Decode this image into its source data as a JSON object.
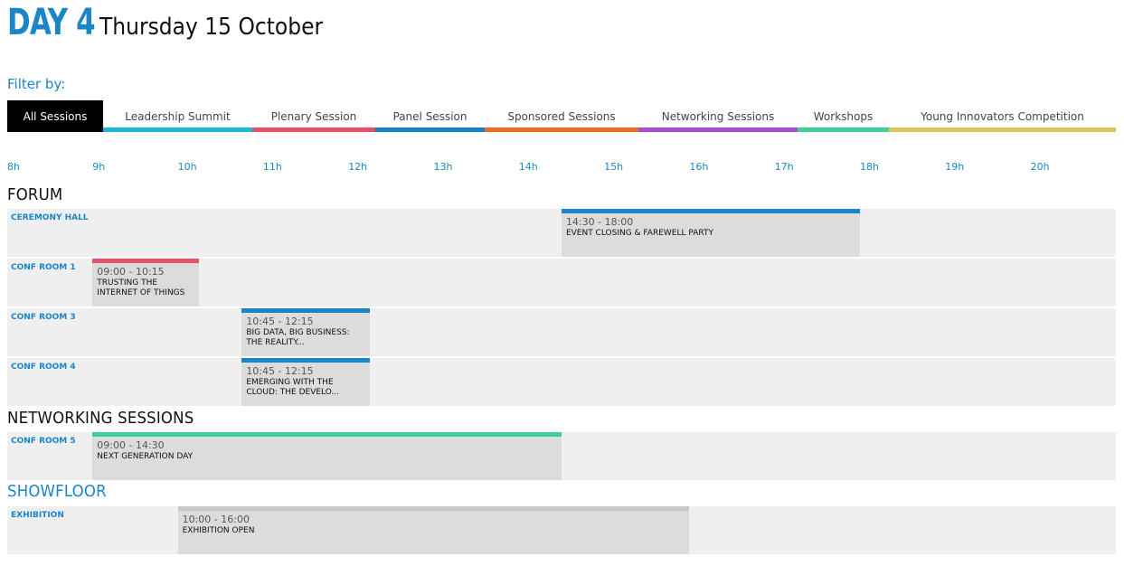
{
  "header": {
    "day": "DAY 4",
    "date": "Thursday 15 October"
  },
  "filter": {
    "label": "Filter by:",
    "tabs": [
      {
        "label": "All Sessions",
        "color": "#000000",
        "active": true
      },
      {
        "label": "Leadership Summit",
        "color": "#20b8d4"
      },
      {
        "label": "Plenary Session",
        "color": "#e8506a"
      },
      {
        "label": "Panel Session",
        "color": "#1a7fc4"
      },
      {
        "label": "Sponsored Sessions",
        "color": "#f06a1e"
      },
      {
        "label": "Networking Sessions",
        "color": "#a64fd0"
      },
      {
        "label": "Workshops",
        "color": "#3fcf9a"
      },
      {
        "label": "Young Innovators Competition",
        "color": "#d9c45a"
      }
    ]
  },
  "hours": [
    "8h",
    "9h",
    "10h",
    "11h",
    "12h",
    "13h",
    "14h",
    "15h",
    "16h",
    "17h",
    "18h",
    "19h",
    "20h"
  ],
  "sections": [
    {
      "title": "FORUM",
      "highlight": false,
      "rooms": [
        {
          "name": "CEREMONY HALL",
          "events": [
            {
              "time": "14:30 - 18:00",
              "title": "EVENT CLOSING & FAREWELL PARTY",
              "color": "#1a86c8"
            }
          ]
        },
        {
          "name": "CONF ROOM 1",
          "events": [
            {
              "time": "09:00 - 10:15",
              "title": "TRUSTING THE INTERNET OF THINGS",
              "color": "#e8506a"
            }
          ]
        },
        {
          "name": "CONF ROOM 3",
          "events": [
            {
              "time": "10:45 - 12:15",
              "title": "BIG DATA, BIG BUSINESS: THE REALITY...",
              "color": "#1a86c8"
            }
          ]
        },
        {
          "name": "CONF ROOM 4",
          "events": [
            {
              "time": "10:45 - 12:15",
              "title": "EMERGING WITH THE CLOUD: THE DEVELO...",
              "color": "#1a86c8"
            }
          ]
        }
      ]
    },
    {
      "title": "NETWORKING SESSIONS",
      "highlight": false,
      "rooms": [
        {
          "name": "CONF ROOM 5",
          "events": [
            {
              "time": "09:00 - 14:30",
              "title": "NEXT GENERATION DAY",
              "color": "#3fcf9a"
            }
          ]
        }
      ]
    },
    {
      "title": "SHOWFLOOR",
      "highlight": true,
      "rooms": [
        {
          "name": "EXHIBITION",
          "events": [
            {
              "time": "10:00 - 16:00",
              "title": "EXHIBITION OPEN",
              "color": "#c8c8c8"
            }
          ]
        }
      ]
    }
  ]
}
